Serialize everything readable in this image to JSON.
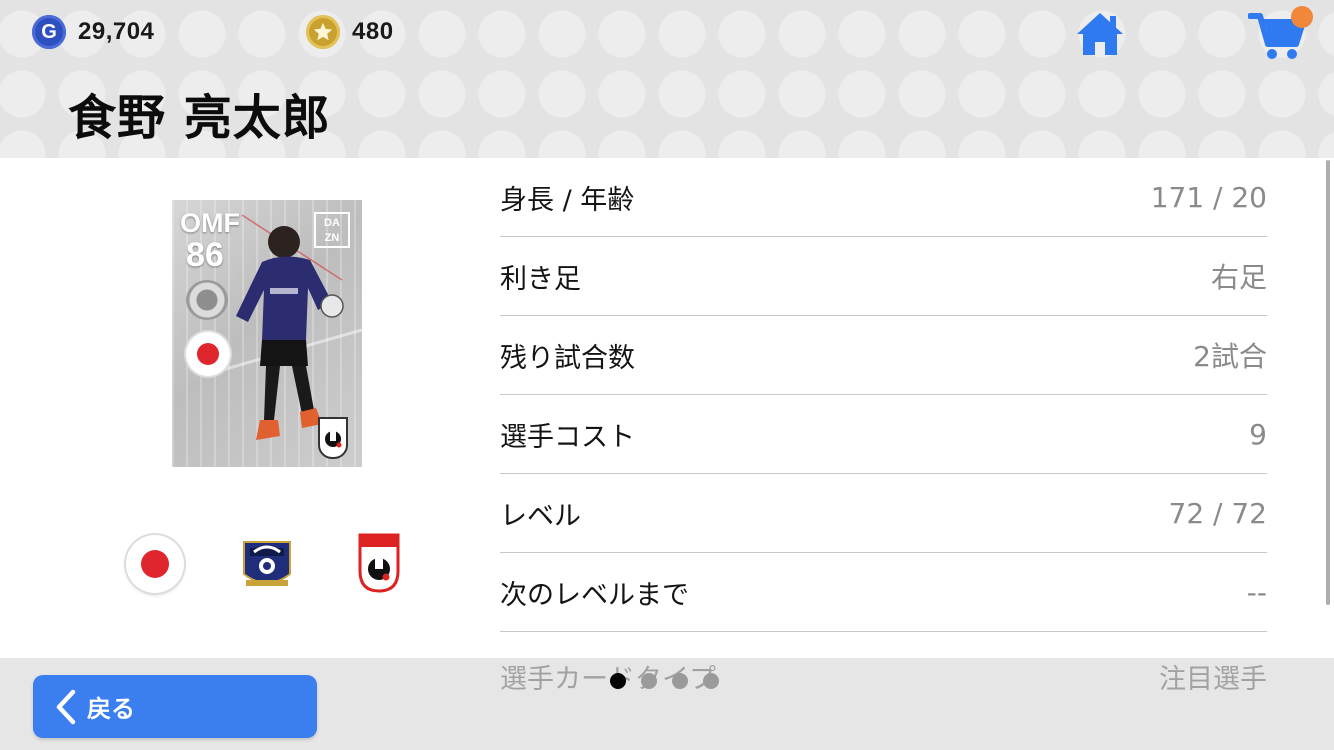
{
  "header": {
    "gp": {
      "icon": "gp-icon",
      "letter": "G",
      "value": "29,704"
    },
    "coins": {
      "icon": "coin-icon",
      "value": "480"
    },
    "home_icon": "home-icon",
    "cart_icon": "cart-icon",
    "player_name": "食野 亮太郎"
  },
  "card": {
    "position": "OMF",
    "rating": "86",
    "broadcaster_lines": [
      "DA",
      "ZN"
    ],
    "nationality_flag": "japan-flag",
    "league_logo": "j-league-logo"
  },
  "badges": {
    "nationality": "japan-flag-icon",
    "club": "gamba-osaka-emblem",
    "league": "j-league-emblem"
  },
  "info_rows": [
    {
      "label": "身長 / 年齢",
      "value": "171 / 20"
    },
    {
      "label": "利き足",
      "value": "右足"
    },
    {
      "label": "残り試合数",
      "value": "2試合"
    },
    {
      "label": "選手コスト",
      "value": "9"
    },
    {
      "label": "レベル",
      "value": "72 / 72"
    },
    {
      "label": "次のレベルまで",
      "value": "--"
    }
  ],
  "faded_row": {
    "label": "選手カードタイプ",
    "value": "注目選手"
  },
  "footer": {
    "back_label": "戻る",
    "back_icon": "chevron-left-icon",
    "page_count": 4,
    "active_page": 1
  },
  "colors": {
    "accent": "#3a7ef0",
    "icon_blue": "#2f7af0",
    "notification": "#f0873a",
    "flag_red": "#e0262d"
  }
}
